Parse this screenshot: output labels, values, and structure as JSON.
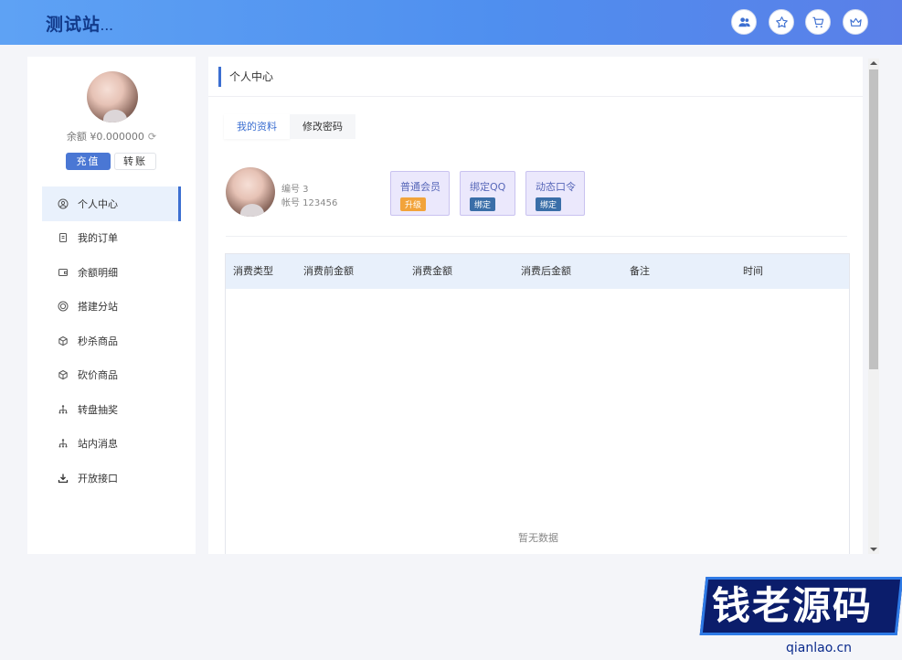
{
  "header": {
    "logo": "测试站",
    "logo_dots": "...",
    "icons": [
      "user-group-icon",
      "star-icon",
      "cart-icon",
      "crown-icon"
    ]
  },
  "sidebar": {
    "balance_label": "余额 ¥0.000000",
    "recharge_label": "充值",
    "transfer_label": "转账",
    "items": [
      {
        "label": "个人中心",
        "icon": "user-circle-icon",
        "active": true
      },
      {
        "label": "我的订单",
        "icon": "order-icon"
      },
      {
        "label": "余额明细",
        "icon": "wallet-icon"
      },
      {
        "label": "搭建分站",
        "icon": "site-icon"
      },
      {
        "label": "秒杀商品",
        "icon": "box-icon"
      },
      {
        "label": "砍价商品",
        "icon": "box-icon"
      },
      {
        "label": "转盘抽奖",
        "icon": "tree-icon"
      },
      {
        "label": "站内消息",
        "icon": "tree-icon"
      },
      {
        "label": "开放接口",
        "icon": "download-icon"
      }
    ]
  },
  "main": {
    "title": "个人中心",
    "tabs": [
      "我的资料",
      "修改密码"
    ],
    "profile": {
      "id_label": "编号 3",
      "account_label": "帐号 123456"
    },
    "cards": [
      {
        "title": "普通会员",
        "badge": "升级",
        "badge_color": "#f2a33a"
      },
      {
        "title": "绑定QQ",
        "badge": "绑定",
        "badge_color": "#3a6ea8"
      },
      {
        "title": "动态口令",
        "badge": "绑定",
        "badge_color": "#3a6ea8"
      }
    ],
    "table": {
      "columns": [
        "消费类型",
        "消费前金额",
        "消费金额",
        "消费后金额",
        "备注",
        "时间"
      ],
      "rows": [],
      "empty_text": "暂无数据"
    }
  },
  "watermark": {
    "text": "钱老源码",
    "url": "qianlao.cn"
  },
  "colors": {
    "accent": "#3c6fd1",
    "header_start": "#5ea2f4",
    "header_end": "#5a7fe8"
  }
}
